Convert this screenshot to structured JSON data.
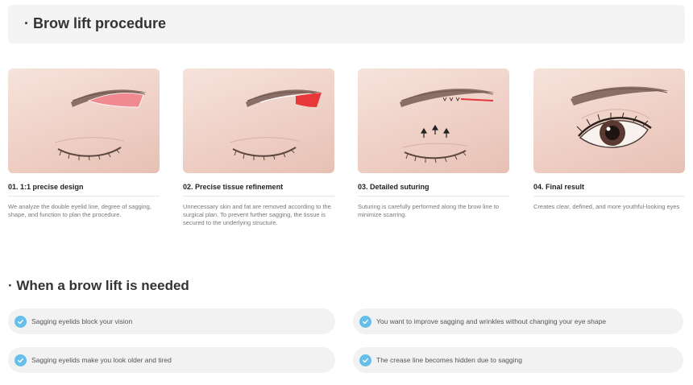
{
  "procedure": {
    "title": "· Brow lift procedure",
    "steps": [
      {
        "title": "01. 1:1 precise design",
        "description": "We analyze the double eyelid line, degree of sagging, shape, and function to plan the procedure."
      },
      {
        "title": "02. Precise tissue refinement",
        "description": "Unnecessary skin and fat are removed according to the surgical plan. To prevent further sagging, the tissue is secured to the underlying structure."
      },
      {
        "title": "03. Detailed suturing",
        "description": "Suturing is carefully performed along the brow line to minimize scarring."
      },
      {
        "title": "04. Final result",
        "description": "Creates clear, defined, and more youthful-looking eyes"
      }
    ]
  },
  "needed": {
    "title": "· When a brow lift is needed",
    "items": [
      "Sagging eyelids block your vision",
      "You want to improve sagging and wrinkles without changing your eye shape",
      "Sagging eyelids make you look older and tired",
      "The crease line becomes hidden due to sagging"
    ],
    "check_icon": "check-circle-icon",
    "check_color": "#66bfe8"
  },
  "colors": {
    "skin": "#efd0c6",
    "incision_red": "#e8373a",
    "incision_pink": "#f08a90"
  }
}
